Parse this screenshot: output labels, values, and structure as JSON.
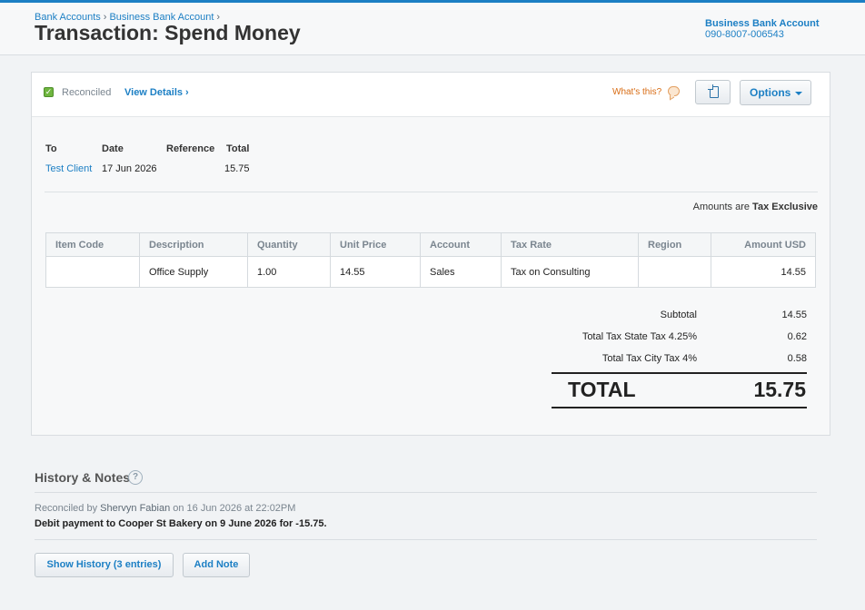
{
  "header": {
    "breadcrumb": [
      "Bank Accounts",
      "Business Bank Account"
    ],
    "breadcrumb_separator": "›",
    "title": "Transaction: Spend Money",
    "account_name": "Business Bank Account",
    "account_number": "090-8007-006543"
  },
  "status_bar": {
    "status": "Reconciled",
    "view_details": "View Details ›",
    "whats_this": "What's this?",
    "options_label": "Options",
    "icons": [
      "check-icon",
      "speech-bubble-icon",
      "copy-document-icon",
      "chevron-down-icon"
    ]
  },
  "transaction": {
    "labels": {
      "to": "To",
      "date": "Date",
      "reference": "Reference",
      "total": "Total"
    },
    "to": "Test Client",
    "date": "17 Jun 2026",
    "reference": "",
    "total": "15.75"
  },
  "tax_note": {
    "prefix": "Amounts are",
    "mode": "Tax Exclusive"
  },
  "line_items": {
    "columns": [
      "Item Code",
      "Description",
      "Quantity",
      "Unit Price",
      "Account",
      "Tax Rate",
      "Region",
      "Amount USD"
    ],
    "rows": [
      {
        "item_code": "",
        "description": "Office Supply",
        "quantity": "1.00",
        "unit_price": "14.55",
        "account": "Sales",
        "tax_rate": "Tax on Consulting",
        "region": "",
        "amount": "14.55"
      }
    ]
  },
  "summary": {
    "subtotal_label": "Subtotal",
    "subtotal": "14.55",
    "tax1_label": "Total Tax State Tax 4.25%",
    "tax1": "0.62",
    "tax2_label": "Total Tax City Tax 4%",
    "tax2": "0.58",
    "total_label": "TOTAL",
    "total": "15.75"
  },
  "history": {
    "title": "History & Notes",
    "help": "?",
    "entry_prefix": "Reconciled by",
    "entry_user": "Shervyn Fabian",
    "entry_when": "on 16 Jun 2026 at 22:02PM",
    "entry_text": "Debit payment to Cooper St Bakery on 9 June 2026 for -15.75.",
    "show_history_label": "Show History (3 entries)",
    "add_note_label": "Add Note"
  },
  "colors": {
    "accent": "#1c7fc4",
    "reconciled_green": "#6fb53f",
    "whats_this_orange": "#d86c14"
  }
}
